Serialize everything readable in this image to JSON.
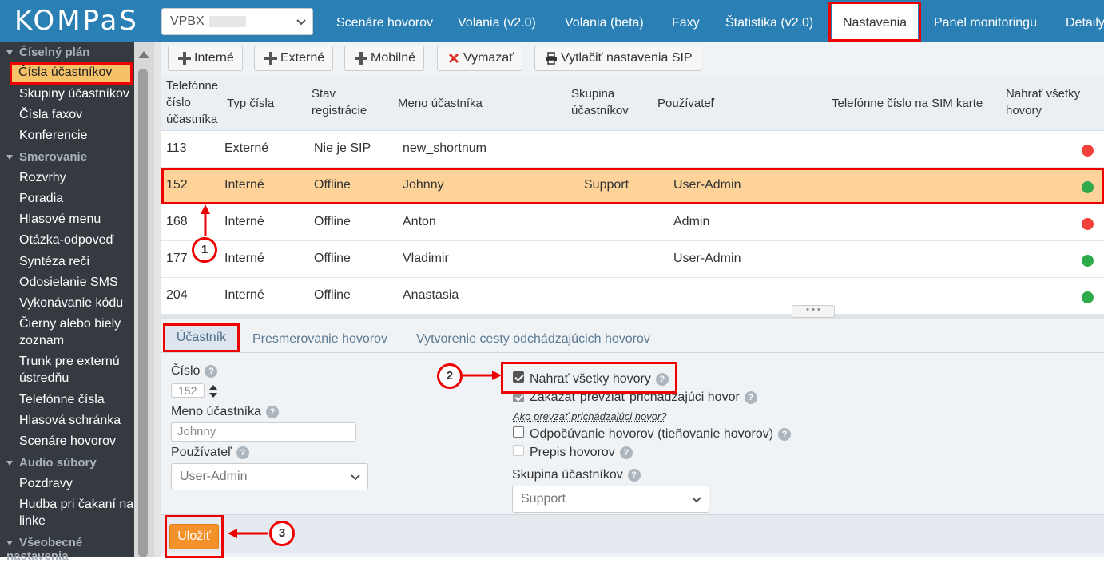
{
  "header": {
    "logo": "KOMPaS",
    "vpbx_select": "VPBX",
    "nav": [
      "Scenáre hovorov",
      "Volania (v2.0)",
      "Volania (beta)",
      "Faxy",
      "Štatistika (v2.0)",
      "Nastavenia",
      "Panel monitoringu",
      "Detaily"
    ],
    "active_nav": "Nastavenia"
  },
  "sidebar": {
    "groups": [
      {
        "label": "Číselný plán",
        "items": [
          "Čísla účastníkov",
          "Skupiny účastníkov",
          "Čísla faxov",
          "Konferencie"
        ]
      },
      {
        "label": "Smerovanie",
        "items": [
          "Rozvrhy",
          "Poradia",
          "Hlasové menu",
          "Otázka-odpoveď",
          "Syntéza reči",
          "Odosielanie SMS",
          "Vykonávanie kódu",
          "Čierny alebo biely zoznam",
          "Trunk pre externú ústredňu",
          "Telefónne čísla",
          "Hlasová schránka",
          "Scenáre hovorov"
        ]
      },
      {
        "label": "Audio súbory",
        "items": [
          "Pozdravy",
          "Hudba pri čakaní na linke"
        ]
      },
      {
        "label": "Všeobecné nastavenia",
        "items": []
      }
    ],
    "active_item": "Čísla účastníkov"
  },
  "toolbar": {
    "internal": "Interné",
    "external": "Externé",
    "mobile": "Mobilné",
    "delete": "Vymazať",
    "print": "Vytlačiť nastavenia SIP"
  },
  "table": {
    "headers": [
      "Telefónne číslo účastníka",
      "Typ čísla",
      "Stav registrácie",
      "Meno účastníka",
      "Skupina účastníkov",
      "Používateľ",
      "Telefónne číslo na SIM karte",
      "Nahrať všetky hovory"
    ],
    "rows": [
      {
        "number": "113",
        "type": "Externé",
        "status": "Nie je SIP",
        "name": "new_shortnum",
        "group": "",
        "user": "",
        "sim": "",
        "record": "red"
      },
      {
        "number": "152",
        "type": "Interné",
        "status": "Offline",
        "name": "Johnny",
        "group": "Support",
        "user": "User-Admin",
        "sim": "",
        "record": "green"
      },
      {
        "number": "168",
        "type": "Interné",
        "status": "Offline",
        "name": "Anton",
        "group": "",
        "user": "Admin",
        "sim": "",
        "record": "red"
      },
      {
        "number": "177",
        "type": "Interné",
        "status": "Offline",
        "name": "Vladimir",
        "group": "",
        "user": "User-Admin",
        "sim": "",
        "record": "green"
      },
      {
        "number": "204",
        "type": "Interné",
        "status": "Offline",
        "name": "Anastasia",
        "group": "",
        "user": "",
        "sim": "",
        "record": "green"
      }
    ],
    "selected_row": "152"
  },
  "tabs": [
    "Účastník",
    "Presmerovanie hovorov",
    "Vytvorenie cesty odchádzajúcich hovorov"
  ],
  "form": {
    "number_label": "Číslo",
    "number_value": "152",
    "name_label": "Meno účastníka",
    "name_value": "Johnny",
    "user_label": "Používateľ",
    "user_value": "User-Admin",
    "record_all": "Nahrať všetky hovory",
    "forbid_pickup": "Zakázať prevziať prichádzajúci hovor",
    "pickup_hint": "Ako prevzať prichádzajúci hovor?",
    "eavesdrop": "Odpočúvanie hovorov (tieňovanie hovorov)",
    "transcription": "Prepis hovorov",
    "group_label": "Skupina účastníkov",
    "group_value": "Support",
    "help": "?"
  },
  "save": "Uložiť",
  "callouts": [
    "1",
    "2",
    "3"
  ],
  "colors": {
    "nav": "#2a7fb4",
    "highlight": "#e00000",
    "selected_row": "#fdd39a",
    "save": "#f5912a",
    "status_red": "#f2413a",
    "status_green": "#2faa4a"
  }
}
